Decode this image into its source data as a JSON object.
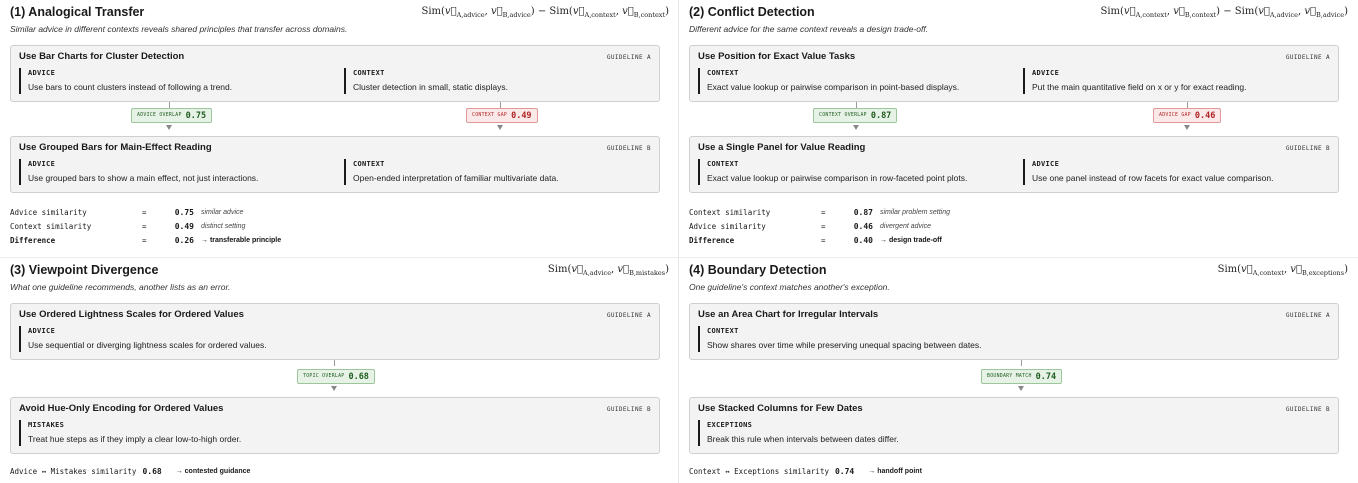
{
  "panels": [
    {
      "title": "(1) Analogical Transfer",
      "subtitle": "Similar advice in different contexts reveals shared principles that transfer across domains.",
      "formula": {
        "t1": "advice",
        "t2": "advice",
        "t3": "context",
        "t4": "context"
      },
      "guideline_a": {
        "title": "Use Bar Charts for Cluster Detection",
        "tag": "GUIDELINE A",
        "left_label": "ADVICE",
        "left_text": "Use bars to count clusters instead of following a trend.",
        "right_label": "CONTEXT",
        "right_text": "Cluster detection in small, static displays."
      },
      "badges": [
        {
          "label": "ADVICE OVERLAP",
          "value": "0.75"
        },
        {
          "label": "CONTEXT GAP",
          "value": "0.49"
        }
      ],
      "guideline_b": {
        "title": "Use Grouped Bars for Main-Effect Reading",
        "tag": "GUIDELINE B",
        "left_label": "ADVICE",
        "left_text": "Use grouped bars to show a main effect, not just interactions.",
        "right_label": "CONTEXT",
        "right_text": "Open-ended interpretation of familiar multivariate data."
      },
      "summary": [
        {
          "label": "Advice similarity",
          "eq": "=",
          "value": "0.75",
          "note": "similar advice"
        },
        {
          "label": "Context similarity",
          "eq": "=",
          "value": "0.49",
          "note": "distinct setting"
        },
        {
          "label": "Difference",
          "eq": "=",
          "value": "0.26",
          "note": "→ transferable principle"
        }
      ]
    },
    {
      "title": "(2) Conflict Detection",
      "subtitle": "Different advice for the same context reveals a design trade-off.",
      "formula": {
        "t1": "context",
        "t2": "context",
        "t3": "advice",
        "t4": "advice"
      },
      "guideline_a": {
        "title": "Use Position for Exact Value Tasks",
        "tag": "GUIDELINE A",
        "left_label": "CONTEXT",
        "left_text": "Exact value lookup or pairwise comparison in point-based displays.",
        "right_label": "ADVICE",
        "right_text": "Put the main quantitative field on x or y for exact reading."
      },
      "badges": [
        {
          "label": "CONTEXT OVERLAP",
          "value": "0.87"
        },
        {
          "label": "ADVICE GAP",
          "value": "0.46"
        }
      ],
      "guideline_b": {
        "title": "Use a Single Panel for Value Reading",
        "tag": "GUIDELINE B",
        "left_label": "CONTEXT",
        "left_text": "Exact value lookup or pairwise comparison in row-faceted point plots.",
        "right_label": "ADVICE",
        "right_text": "Use one panel instead of row facets for exact value comparison."
      },
      "summary": [
        {
          "label": "Context similarity",
          "eq": "=",
          "value": "0.87",
          "note": "similar problem setting"
        },
        {
          "label": "Advice similarity",
          "eq": "=",
          "value": "0.46",
          "note": "divergent advice"
        },
        {
          "label": "Difference",
          "eq": "=",
          "value": "0.40",
          "note": "→ design trade-off"
        }
      ]
    },
    {
      "title": "(3) Viewpoint Divergence",
      "subtitle": "What one guideline recommends, another lists as an error.",
      "formula": {
        "t1": "advice",
        "t2": "mistakes"
      },
      "guideline_a": {
        "title": "Use Ordered Lightness Scales for Ordered Values",
        "tag": "GUIDELINE A",
        "label": "ADVICE",
        "text": "Use sequential or diverging lightness scales for ordered values."
      },
      "badge": {
        "label": "TOPIC OVERLAP",
        "value": "0.68"
      },
      "guideline_b": {
        "title": "Avoid Hue-Only Encoding for Ordered Values",
        "tag": "GUIDELINE B",
        "label": "MISTAKES",
        "text": "Treat hue steps as if they imply a clear low-to-high order."
      },
      "summary": {
        "label": "Advice ↔ Mistakes similarity",
        "value": "0.68",
        "note": "→ contested guidance"
      }
    },
    {
      "title": "(4) Boundary Detection",
      "subtitle": "One guideline's context matches another's exception.",
      "formula": {
        "t1": "context",
        "t2": "exceptions"
      },
      "guideline_a": {
        "title": "Use an Area Chart for Irregular Intervals",
        "tag": "GUIDELINE A",
        "label": "CONTEXT",
        "text": "Show shares over time while preserving unequal spacing between dates."
      },
      "badge": {
        "label": "BOUNDARY MATCH",
        "value": "0.74"
      },
      "guideline_b": {
        "title": "Use Stacked Columns for Few Dates",
        "tag": "GUIDELINE B",
        "label": "EXCEPTIONS",
        "text": "Break this rule when intervals between dates differ."
      },
      "summary": {
        "label": "Context ↔ Exceptions similarity",
        "value": "0.74",
        "note": "→ handoff point"
      }
    }
  ]
}
